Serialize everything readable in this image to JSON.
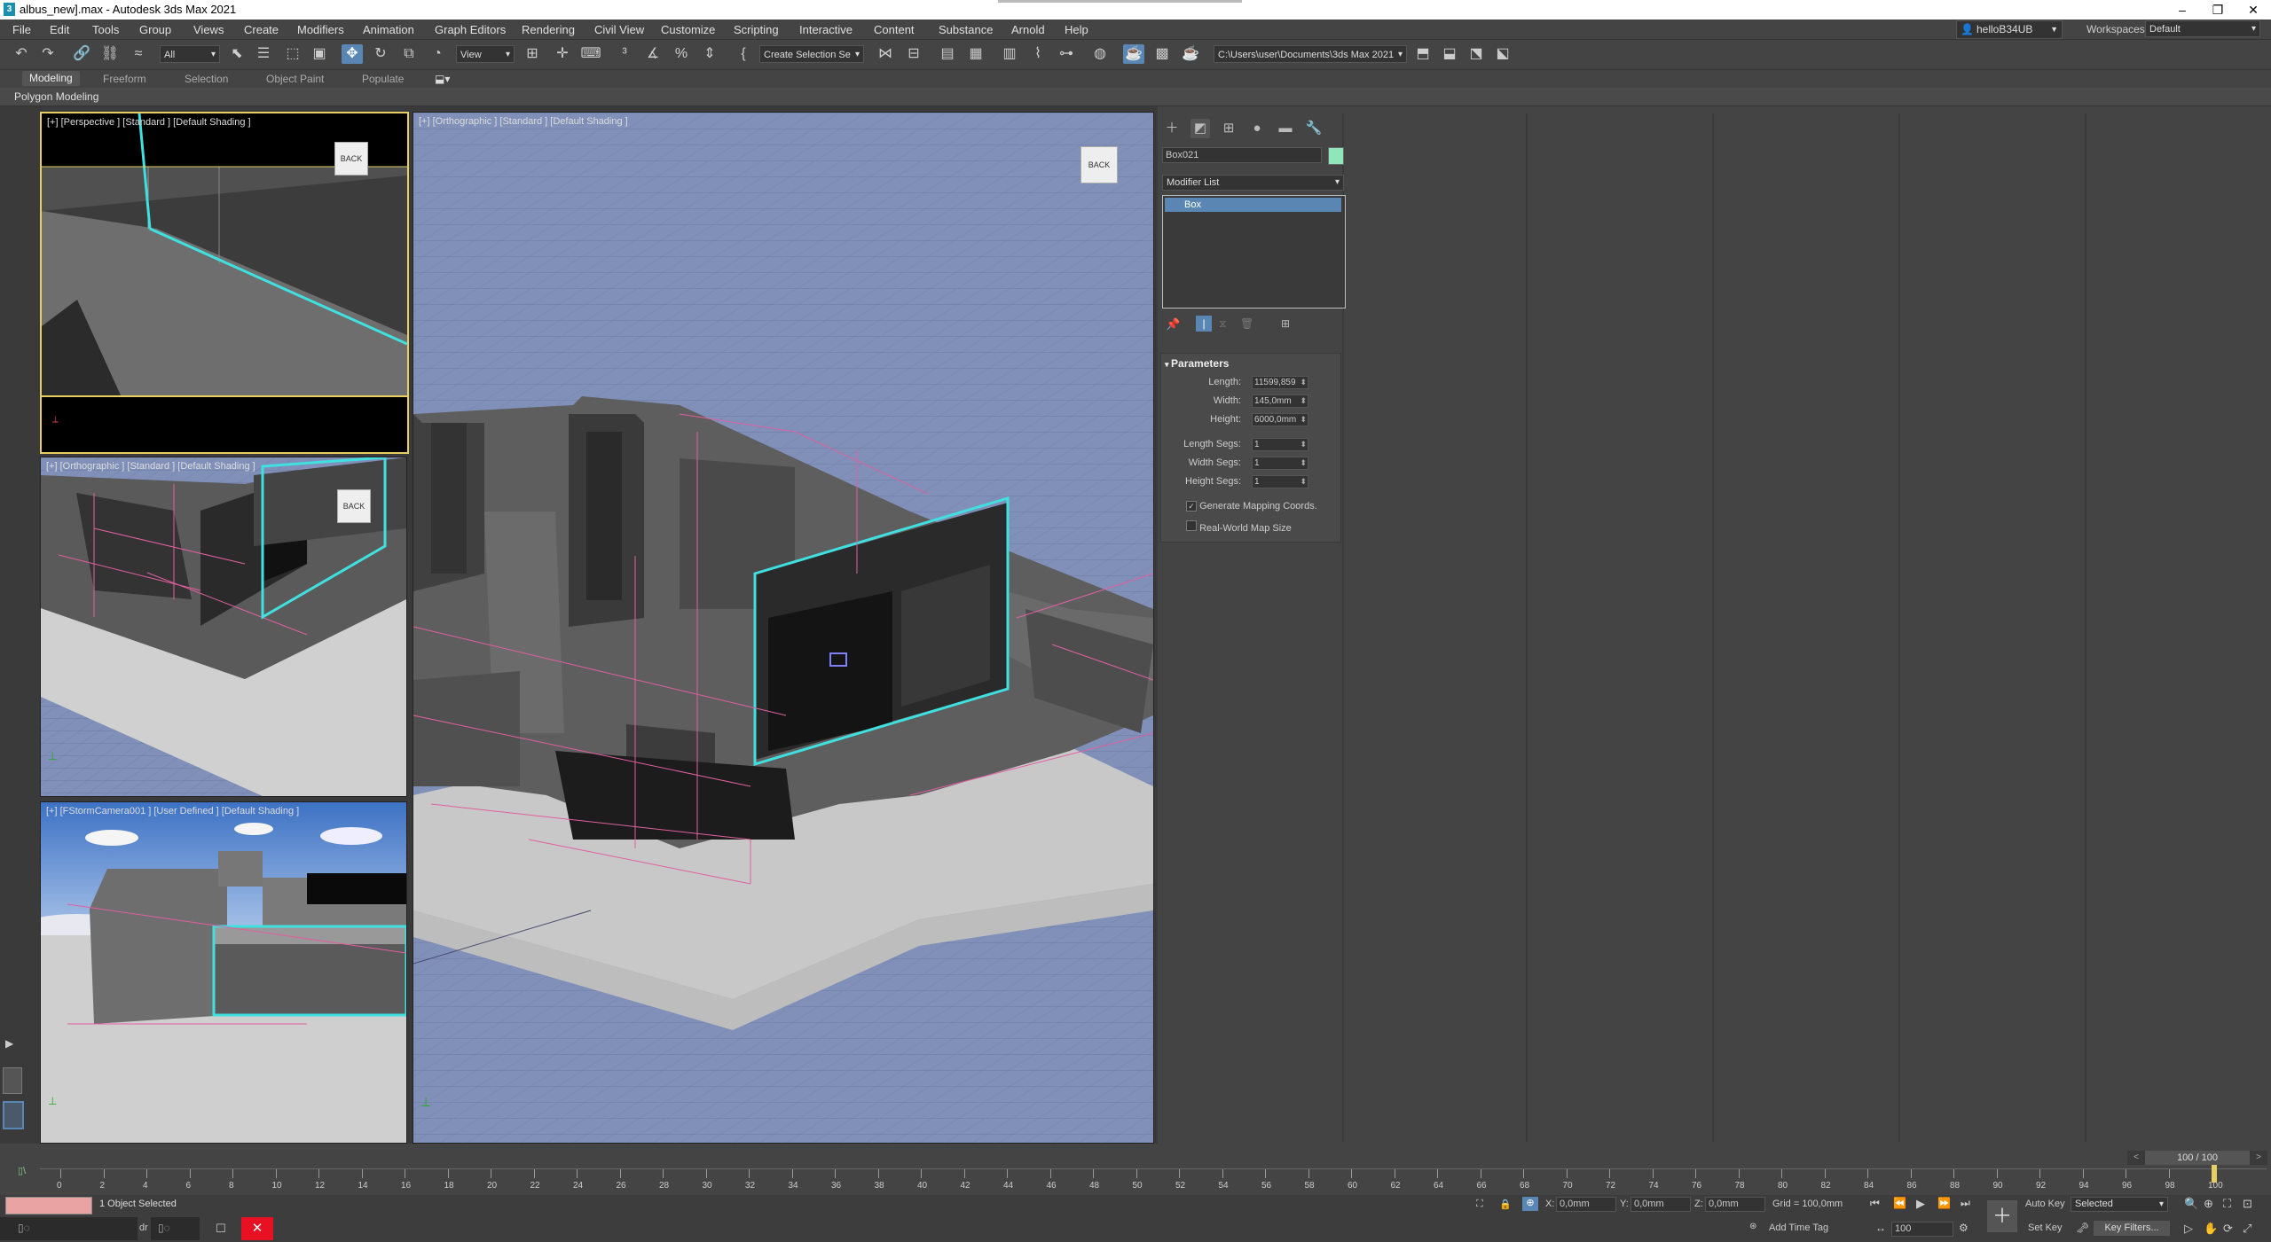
{
  "window": {
    "title": "albus_new].max - Autodesk 3ds Max 2021",
    "app_icon": "3"
  },
  "window_controls": {
    "minimize": "–",
    "maximize": "❐",
    "close": "✕"
  },
  "menu": [
    "File",
    "Edit",
    "Tools",
    "Group",
    "Views",
    "Create",
    "Modifiers",
    "Animation",
    "Graph Editors",
    "Rendering",
    "Civil View",
    "Customize",
    "Scripting",
    "Interactive",
    "Content",
    "Substance",
    "Arnold",
    "Help"
  ],
  "user": {
    "name": "helloB34UB"
  },
  "workspace": {
    "label": "Workspaces:",
    "value": "Default"
  },
  "toolbar": {
    "filter_value": "All",
    "view_value": "View",
    "selection_set_placeholder": "Create Selection Se",
    "project_path": "C:\\Users\\user\\Documents\\3ds Max 2021"
  },
  "ribbon": {
    "tabs": [
      "Modeling",
      "Freeform",
      "Selection",
      "Object Paint",
      "Populate"
    ],
    "active": "Modeling",
    "sub": "Polygon Modeling"
  },
  "viewports": {
    "perspective": "[+] [Perspective ] [Standard ] [Default Shading ]",
    "ortho_main": "[+] [Orthographic ] [Standard ] [Default Shading ]",
    "ortho_small": "[+] [Orthographic ] [Standard ] [Default Shading ]",
    "camera": "[+] [FStormCamera001 ] [User Defined ] [Default Shading ]",
    "viewcube_label": "BACK"
  },
  "command_panel": {
    "tabs": [
      "create-icon",
      "modify-icon",
      "hierarchy-icon",
      "motion-icon",
      "display-icon",
      "utilities-icon"
    ],
    "object_name": "Box021",
    "object_color": "#8fe6b8",
    "modifier_list": "Modifier List",
    "stack_items": [
      "Box"
    ],
    "rollout_title": "Parameters",
    "params": [
      {
        "label": "Length:",
        "value": "11599,859"
      },
      {
        "label": "Width:",
        "value": "145,0mm"
      },
      {
        "label": "Height:",
        "value": "6000,0mm"
      },
      {
        "label": "Length Segs:",
        "value": "1"
      },
      {
        "label": "Width Segs:",
        "value": "1"
      },
      {
        "label": "Height Segs:",
        "value": "1"
      }
    ],
    "checkboxes": [
      {
        "label": "Generate Mapping Coords.",
        "checked": true
      },
      {
        "label": "Real-World Map Size",
        "checked": false
      }
    ]
  },
  "timeline": {
    "frame_display": "100 / 100",
    "ticks": [
      "0",
      "2",
      "4",
      "6",
      "8",
      "10",
      "12",
      "14",
      "16",
      "18",
      "20",
      "22",
      "24",
      "26",
      "28",
      "30",
      "32",
      "34",
      "36",
      "38",
      "40",
      "42",
      "44",
      "46",
      "48",
      "50",
      "52",
      "54",
      "56",
      "58",
      "60",
      "62",
      "64",
      "66",
      "68",
      "70",
      "72",
      "74",
      "76",
      "78",
      "80",
      "82",
      "84",
      "86",
      "88",
      "90",
      "92",
      "94",
      "96",
      "98",
      "100"
    ]
  },
  "status": {
    "selected_text": "1 Object Selected",
    "x_label": "X:",
    "x_value": "0,0mm",
    "y_label": "Y:",
    "y_value": "0,0mm",
    "z_label": "Z:",
    "z_value": "0,0mm",
    "grid": "Grid = 100,0mm",
    "add_time_tag": "Add Time Tag",
    "auto_key": "Auto Key",
    "set_key": "Set Key",
    "selected_dropdown": "Selected",
    "key_filters": "Key Filters...",
    "frame_field": "100",
    "script_prefix": "dr"
  },
  "colors": {
    "accent": "#5a86b4",
    "active_viewport": "#e6cf62",
    "selection_cyan": "#40e0e0",
    "helper_pink": "#e060a0",
    "grid_blue": "#8090b8"
  }
}
